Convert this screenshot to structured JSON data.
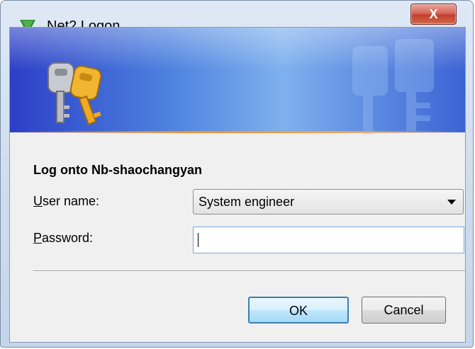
{
  "window": {
    "title": "Net2 Logon",
    "close_label": "X"
  },
  "icons": {
    "app": "green-triangle-icon",
    "banner": "keys-icon",
    "watermark": "keys-watermark-icon"
  },
  "colors": {
    "banner_blue": "#3b63d4",
    "banner_accent": "#f58d2a",
    "app_icon_green": "#2f8a2f",
    "close_red": "#c1402f"
  },
  "form": {
    "heading": "Log onto Nb-shaochangyan",
    "user_label_accel": "U",
    "user_label_rest": "ser name:",
    "user_value": "System engineer",
    "password_label_accel": "P",
    "password_label_rest": "assword:",
    "password_value": ""
  },
  "buttons": {
    "ok": "OK",
    "cancel": "Cancel"
  }
}
